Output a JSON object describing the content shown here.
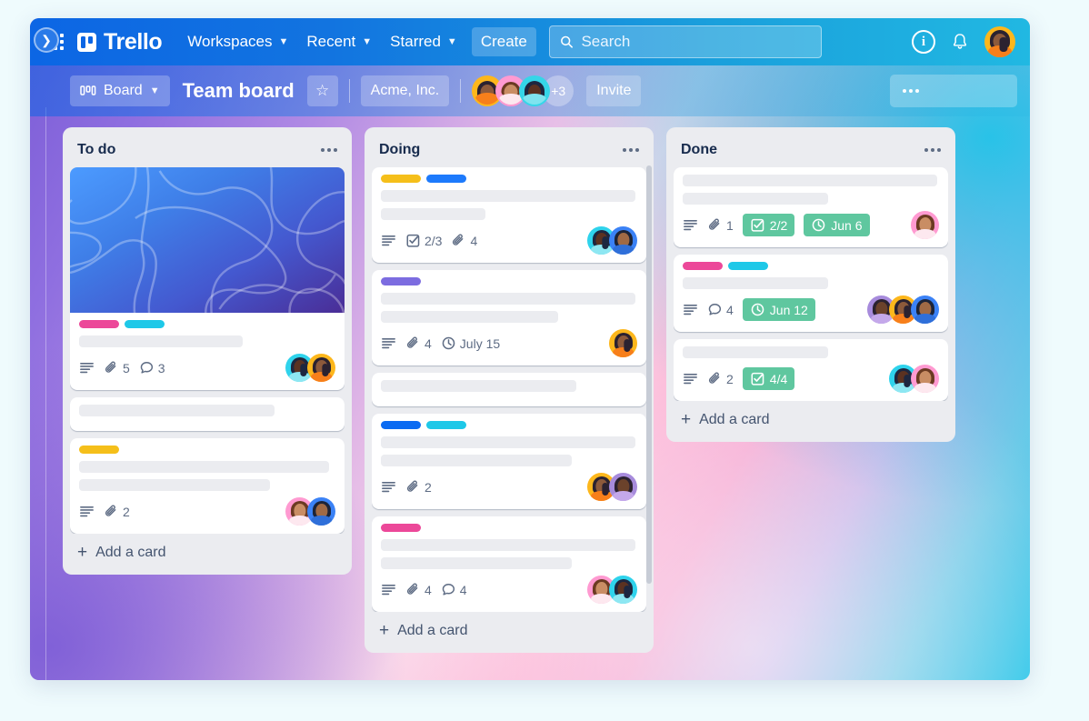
{
  "topnav": {
    "apps_icon": "apps-grid-icon",
    "brand": "Trello",
    "workspaces": "Workspaces",
    "recent": "Recent",
    "starred": "Starred",
    "create": "Create",
    "search_placeholder": "Search",
    "search_value": "",
    "info_icon": "info-icon",
    "bell_icon": "notification-bell-icon",
    "account_avatar": "user-avatar"
  },
  "board_header": {
    "view_label": "Board",
    "title": "Team board",
    "star_icon": "star-icon",
    "workspace": "Acme, Inc.",
    "more_members": "+3",
    "invite": "Invite",
    "menu_icon": "board-menu-icon",
    "sidebar_toggle_icon": "chevron-right-icon"
  },
  "colors": {
    "label_pink": "#ec4899",
    "label_cyan": "#1ec8e8",
    "label_yellow": "#f5bf1a",
    "label_blue": "#1d7afc",
    "label_purple": "#7c6ce0",
    "label_brightblue": "#0b6bf2",
    "badge_green": "#5fc79f",
    "nav_blue": "#0c66e4",
    "list_bg": "#ebecf0"
  },
  "lists": [
    {
      "title": "To do",
      "menu": "list-menu-icon",
      "add_card": "Add a card",
      "cards": [
        {
          "cover": true,
          "labels": [
            "label_pink",
            "label_cyan"
          ],
          "skeletons": [
            180
          ],
          "badges": [
            {
              "icon": "description-icon",
              "text": ""
            },
            {
              "icon": "attachment-icon",
              "text": "5"
            },
            {
              "icon": "comment-icon",
              "text": "3"
            }
          ],
          "avatars": [
            "cyan-dark",
            "yellow-dark"
          ]
        },
        {
          "cover": false,
          "labels": [],
          "skeletons": [
            215
          ],
          "badges": [],
          "avatars": []
        },
        {
          "cover": false,
          "labels": [
            "label_yellow"
          ],
          "skeletons": [
            275,
            210
          ],
          "badges": [
            {
              "icon": "description-icon",
              "text": ""
            },
            {
              "icon": "attachment-icon",
              "text": "2"
            }
          ],
          "avatars": [
            "pink-light",
            "blue-mid"
          ]
        }
      ]
    },
    {
      "title": "Doing",
      "menu": "list-menu-icon",
      "add_card": "Add a card",
      "cards": [
        {
          "cover": false,
          "labels": [
            "label_yellow",
            "label_blue"
          ],
          "skeletons": [
            280,
            115
          ],
          "badges": [
            {
              "icon": "description-icon",
              "text": ""
            },
            {
              "icon": "checklist-icon",
              "text": "2/3"
            },
            {
              "icon": "attachment-icon",
              "text": "4"
            }
          ],
          "avatars": [
            "cyan-dark",
            "blue-mid"
          ]
        },
        {
          "cover": false,
          "labels": [
            "label_purple"
          ],
          "skeletons": [
            280,
            195
          ],
          "badges": [
            {
              "icon": "description-icon",
              "text": ""
            },
            {
              "icon": "attachment-icon",
              "text": "4"
            },
            {
              "icon": "clock-icon",
              "text": "July 15"
            }
          ],
          "avatars": [
            "yellow-dark"
          ]
        },
        {
          "cover": false,
          "labels": [],
          "skeletons": [
            215
          ],
          "badges": [],
          "avatars": []
        },
        {
          "cover": false,
          "labels": [
            "label_brightblue",
            "label_cyan"
          ],
          "skeletons": [
            280,
            210
          ],
          "badges": [
            {
              "icon": "description-icon",
              "text": ""
            },
            {
              "icon": "attachment-icon",
              "text": "2"
            }
          ],
          "avatars": [
            "yellow-dark",
            "purple-dark"
          ]
        },
        {
          "cover": false,
          "labels": [
            "label_pink"
          ],
          "skeletons": [
            280,
            210
          ],
          "badges": [
            {
              "icon": "description-icon",
              "text": ""
            },
            {
              "icon": "attachment-icon",
              "text": "4"
            },
            {
              "icon": "comment-icon",
              "text": "4"
            }
          ],
          "avatars": [
            "pink-light",
            "cyan-dark"
          ]
        }
      ]
    },
    {
      "title": "Done",
      "menu": "list-menu-icon",
      "add_card": "Add a card",
      "cards": [
        {
          "cover": false,
          "labels": [],
          "skeletons": [
            280,
            160
          ],
          "badges": [
            {
              "icon": "description-icon",
              "text": ""
            },
            {
              "icon": "attachment-icon",
              "text": "1"
            },
            {
              "icon": "checklist-icon",
              "text": "2/2",
              "green": true
            },
            {
              "icon": "clock-icon",
              "text": "Jun 6",
              "green": true
            }
          ],
          "avatars": [
            "pink-light"
          ]
        },
        {
          "cover": false,
          "labels": [
            "label_pink",
            "label_cyan"
          ],
          "skeletons": [
            160
          ],
          "badges": [
            {
              "icon": "description-icon",
              "text": ""
            },
            {
              "icon": "comment-icon",
              "text": "4"
            },
            {
              "icon": "clock-icon",
              "text": "Jun 12",
              "green": true
            }
          ],
          "avatars": [
            "purple-dark",
            "yellow-dark",
            "blue-mid"
          ]
        },
        {
          "cover": false,
          "labels": [],
          "skeletons": [
            160
          ],
          "badges": [
            {
              "icon": "description-icon",
              "text": ""
            },
            {
              "icon": "attachment-icon",
              "text": "2"
            },
            {
              "icon": "checklist-icon",
              "text": "4/4",
              "green": true
            }
          ],
          "avatars": [
            "cyan-dark",
            "pink-light"
          ]
        }
      ]
    }
  ]
}
